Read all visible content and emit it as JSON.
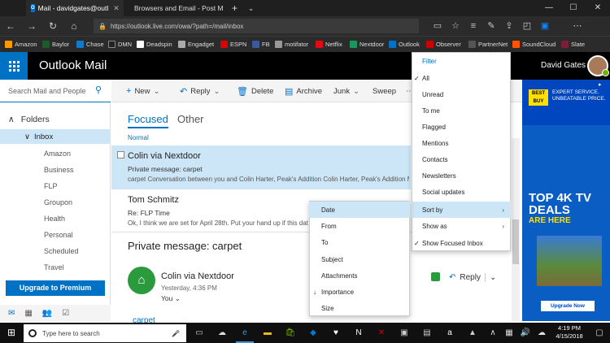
{
  "browser": {
    "tabs": [
      {
        "label": "Mail - davidgates@outl",
        "favicon": "outlook-icon"
      },
      {
        "label": "Browsers and Email - Post M",
        "favicon": "forum-icon"
      }
    ],
    "url": "https://outlook.live.com/owa/?path=/mail/inbox",
    "favorites": [
      "Amazon",
      "Baylor",
      "Chase",
      "DMN",
      "Deadspin",
      "Engadget",
      "ESPN",
      "FB",
      "motifator",
      "Netflix",
      "Nextdoor",
      "Outlook",
      "Observer",
      "PartnerNet",
      "SoundCloud",
      "Slate"
    ]
  },
  "app": {
    "title": "Outlook Mail",
    "user": "David Gates"
  },
  "nav": {
    "search_placeholder": "Search Mail and People",
    "folders_label": "Folders",
    "inbox_label": "Inbox",
    "subfolders": [
      "Amazon",
      "Business",
      "FLP",
      "Groupon",
      "Health",
      "Personal",
      "Scheduled",
      "Travel"
    ],
    "upgrade_label": "Upgrade to Premium"
  },
  "toolbar": {
    "new": "New",
    "reply": "Reply",
    "delete": "Delete",
    "archive": "Archive",
    "junk": "Junk",
    "sweep": "Sweep"
  },
  "list": {
    "tab_focused": "Focused",
    "tab_other": "Other",
    "group": "Normal",
    "messages": [
      {
        "from": "Colin via Nextdoor",
        "subject": "Private message: carpet",
        "preview": "carpet Conversation between you and Colin Harter, Peak's Addition Colin Harter, Peak's Addition My"
      },
      {
        "from": "Tom Schmitz",
        "subject": "Re: FLP Time",
        "preview": "Ok, I think we are set for April 28th. Put your hand up if this date"
      }
    ]
  },
  "reading": {
    "title": "Private message: carpet",
    "sender": "Colin via Nextdoor",
    "date": "Yesterday, 4:36 PM",
    "to": "You",
    "reply": "Reply",
    "body_start": "carpet"
  },
  "filter_menu": {
    "header": "Filter",
    "items": [
      "All",
      "Unread",
      "To me",
      "Flagged",
      "Mentions",
      "Contacts",
      "Newsletters",
      "Social updates",
      "Sort by",
      "Show as",
      "Show Focused Inbox"
    ]
  },
  "sort_menu": {
    "items": [
      "Date",
      "From",
      "To",
      "Subject",
      "Attachments",
      "Importance",
      "Size"
    ]
  },
  "ad": {
    "brand": "BEST BUY",
    "tagline": "EXPERT SERVICE. UNBEATABLE PRICE.",
    "headline": "TOP 4K TV DEALS",
    "sub": "ARE HERE",
    "button": "Upgrade Now"
  },
  "taskbar": {
    "search_placeholder": "Type here to search",
    "time": "4:19 PM",
    "date": "4/15/2018"
  }
}
